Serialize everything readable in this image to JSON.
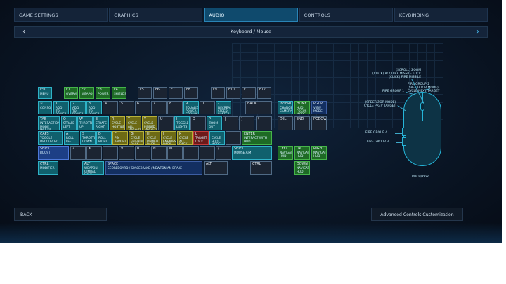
{
  "tabs": [
    {
      "label": "GAME SETTINGS"
    },
    {
      "label": "GRAPHICS"
    },
    {
      "label": "AUDIO"
    },
    {
      "label": "CONTROLS"
    },
    {
      "label": "KEYBINDING"
    }
  ],
  "subheader": {
    "title": "Keyboard / Mouse"
  },
  "footer": {
    "back_label": "BACK",
    "advanced_label": "Advanced Controls Customization"
  },
  "keys": [
    {
      "label": "ESC",
      "action": "MENU",
      "color": "teal"
    },
    {
      "label": "F1",
      "action": "OVERVIEW",
      "color": "green"
    },
    {
      "label": "F2",
      "action": "WEAPONS",
      "color": "green"
    },
    {
      "label": "F3",
      "action": "POWER",
      "color": "green"
    },
    {
      "label": "F4",
      "action": "SHIELDS",
      "color": "green"
    },
    {
      "label": "F5",
      "action": "",
      "color": "dark"
    },
    {
      "label": "F6",
      "action": "",
      "color": "dark"
    },
    {
      "label": "F7",
      "action": "",
      "color": "dark"
    },
    {
      "label": "F8",
      "action": "",
      "color": "dark"
    },
    {
      "label": "F9",
      "action": "",
      "color": "dark"
    },
    {
      "label": "F10",
      "action": "",
      "color": "dark"
    },
    {
      "label": "F11",
      "action": "",
      "color": "dark"
    },
    {
      "label": "F12",
      "action": "",
      "color": "dark"
    },
    {
      "label": "~",
      "action": "CONSOLE",
      "color": "teal"
    },
    {
      "label": "1",
      "action": "ADD TO POWER GROUP 1",
      "color": "teal"
    },
    {
      "label": "2",
      "action": "ADD TO POWER GROUP 2",
      "color": "teal"
    },
    {
      "label": "3",
      "action": "ADD TO POWER GROUP 3",
      "color": "teal"
    },
    {
      "label": "4",
      "action": "",
      "color": "dark"
    },
    {
      "label": "5",
      "action": "",
      "color": "dark"
    },
    {
      "label": "6",
      "action": "",
      "color": "dark"
    },
    {
      "label": "7",
      "action": "",
      "color": "dark"
    },
    {
      "label": "8",
      "action": "",
      "color": "dark"
    },
    {
      "label": "9",
      "action": "EQUALIZE POWER GROUPS",
      "color": "teal"
    },
    {
      "label": "0",
      "action": "",
      "color": "dark"
    },
    {
      "label": "-",
      "action": "DECREASE SPEED LIMITER",
      "color": "teal"
    },
    {
      "label": "BACK",
      "action": "",
      "color": "dark"
    },
    {
      "label": "TAB",
      "action": "INTERACTION MODE (HOLD)",
      "color": "teal"
    },
    {
      "label": "Q",
      "action": "STRAFE LEFT",
      "color": "teal"
    },
    {
      "label": "W",
      "action": "THROTTLE UP",
      "color": "teal"
    },
    {
      "label": "E",
      "action": "STRAFE RIGHT",
      "color": "teal"
    },
    {
      "label": "R",
      "action": "CYCLE HOSTILES",
      "color": "olive"
    },
    {
      "label": "T",
      "action": "CYCLE ALL TARGETS",
      "color": "olive"
    },
    {
      "label": "Y",
      "action": "CYCLE PINNED TARGETS",
      "color": "olive"
    },
    {
      "label": "U",
      "action": "",
      "color": "dark"
    },
    {
      "label": "I",
      "action": "TOGGLE LIGHTS",
      "color": "teal"
    },
    {
      "label": "O",
      "action": "",
      "color": "dark"
    },
    {
      "label": "P",
      "action": "ZOOM OUT",
      "color": "teal"
    },
    {
      "label": "[",
      "action": "",
      "color": "dark"
    },
    {
      "label": "]",
      "action": "",
      "color": "dark"
    },
    {
      "label": "\\",
      "action": "",
      "color": "dark"
    },
    {
      "label": "CAPS",
      "action": "TOGGLE DECOUPLED",
      "color": "teal"
    },
    {
      "label": "A",
      "action": "ROLL LEFT",
      "color": "teal"
    },
    {
      "label": "S",
      "action": "THROTTLE DOWN",
      "color": "teal"
    },
    {
      "label": "D",
      "action": "ROLL RIGHT",
      "color": "teal"
    },
    {
      "label": "F",
      "action": "PIN TARGET",
      "color": "olive"
    },
    {
      "label": "G",
      "action": "CYCLE FRIENDLIES BACK",
      "color": "olive"
    },
    {
      "label": "H",
      "action": "CYCLE PINNED BACK",
      "color": "olive"
    },
    {
      "label": "J",
      "action": "CYCLE ENEMIES BACK",
      "color": "olive"
    },
    {
      "label": "K",
      "action": "CYCLE ALL BACK",
      "color": "olive"
    },
    {
      "label": "L",
      "action": "TARGET LOCK",
      "color": "red"
    },
    {
      "label": ";",
      "action": "CYCLE HUD MODE",
      "color": "teal"
    },
    {
      "label": "'",
      "action": "",
      "color": "dark"
    },
    {
      "label": "ENTER",
      "action": "INTERACT WITH HUD",
      "color": "green"
    },
    {
      "label": "SHIFT",
      "action": "BOOST",
      "color": "blue"
    },
    {
      "label": "Z",
      "action": "",
      "color": "dark"
    },
    {
      "label": "X",
      "action": "",
      "color": "dark"
    },
    {
      "label": "C",
      "action": "",
      "color": "dark"
    },
    {
      "label": "V",
      "action": "",
      "color": "dark"
    },
    {
      "label": "B",
      "action": "",
      "color": "dark"
    },
    {
      "label": "N",
      "action": "",
      "color": "dark"
    },
    {
      "label": "M",
      "action": "",
      "color": "dark"
    },
    {
      "label": ",",
      "action": "",
      "color": "dark"
    },
    {
      "label": ".",
      "action": "",
      "color": "dark"
    },
    {
      "label": "/",
      "action": "",
      "color": "dark"
    },
    {
      "label": "SHIFT",
      "action": "MOUSE AIM",
      "color": "teal"
    },
    {
      "label": "CTRL",
      "action": "MODIFIER",
      "color": "teal"
    },
    {
      "label": "ALT",
      "action": "WEAPON GIMBAL LOCK",
      "color": "teal"
    },
    {
      "label": "SPACE",
      "action": "SCOREBOARD / SPACEBRAKE / NEWTONIAN BRAKE",
      "color": "navy"
    },
    {
      "label": "ALT",
      "action": "",
      "color": "dark"
    },
    {
      "label": "CTRL",
      "action": "",
      "color": "dark"
    },
    {
      "label": "INSERT",
      "action": "CHANGE CAMERA",
      "color": "teal"
    },
    {
      "label": "HOME",
      "action": "HUD FOCUS MODE",
      "color": "green"
    },
    {
      "label": "PGUP",
      "action": "VIEW MODE",
      "color": "navy"
    },
    {
      "label": "DEL",
      "action": "",
      "color": "dark"
    },
    {
      "label": "END",
      "action": "",
      "color": "dark"
    },
    {
      "label": "PGDOWN",
      "action": "",
      "color": "dark"
    },
    {
      "label": "UP",
      "action": "NAVIGATE HUD",
      "color": "green"
    },
    {
      "label": "LEFT",
      "action": "NAVIGATE HUD",
      "color": "green"
    },
    {
      "label": "DOWN",
      "action": "NAVIGATE HUD",
      "color": "green"
    },
    {
      "label": "RIGHT",
      "action": "NAVIGATE HUD",
      "color": "green"
    }
  ],
  "mouse_labels": [
    "(SCROLL) ZOOM\n(CLICK) ACQUIRE MISSILE LOCK\n(CLICK) FIRE MISSILE",
    "FIRE GROUP 1",
    "FIRE GROUP 2\n(SPECTATOR MODE)\nCYCLE NEXT TARGET",
    "(SPECTATOR MODE)\nCYCLE PREV TARGET",
    "FIRE GROUP 4",
    "FIRE GROUP 3",
    "PITCH/YAW"
  ]
}
